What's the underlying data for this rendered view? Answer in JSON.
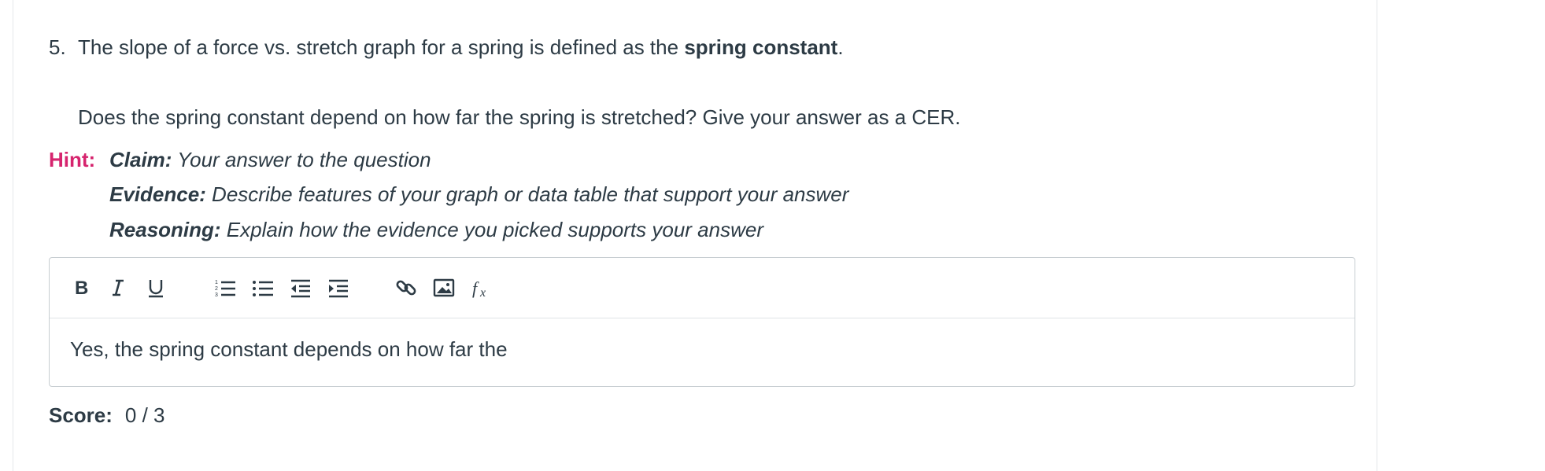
{
  "question": {
    "number": "5.",
    "text_before": "The slope of a force vs. stretch graph for a spring is defined as the ",
    "term": "spring constant",
    "text_after": ".",
    "prompt": "Does the spring constant depend on how far the spring is stretched? Give your answer as a CER."
  },
  "hint": {
    "label": "Hint:",
    "claim_label": "Claim:",
    "claim_text": " Your answer to the question",
    "evidence_label": "Evidence:",
    "evidence_text": " Describe features of your graph or data table that support your answer",
    "reasoning_label": "Reasoning:",
    "reasoning_text": " Explain how the evidence you picked supports your answer"
  },
  "editor": {
    "toolbar": [
      "bold-icon",
      "italic-icon",
      "underline-icon",
      "numbered-list-icon",
      "bulleted-list-icon",
      "outdent-icon",
      "indent-icon",
      "link-icon",
      "image-icon",
      "formula-icon"
    ],
    "content": "Yes, the spring constant depends on how far the"
  },
  "score": {
    "label": "Score:",
    "value": "0 / 3"
  }
}
